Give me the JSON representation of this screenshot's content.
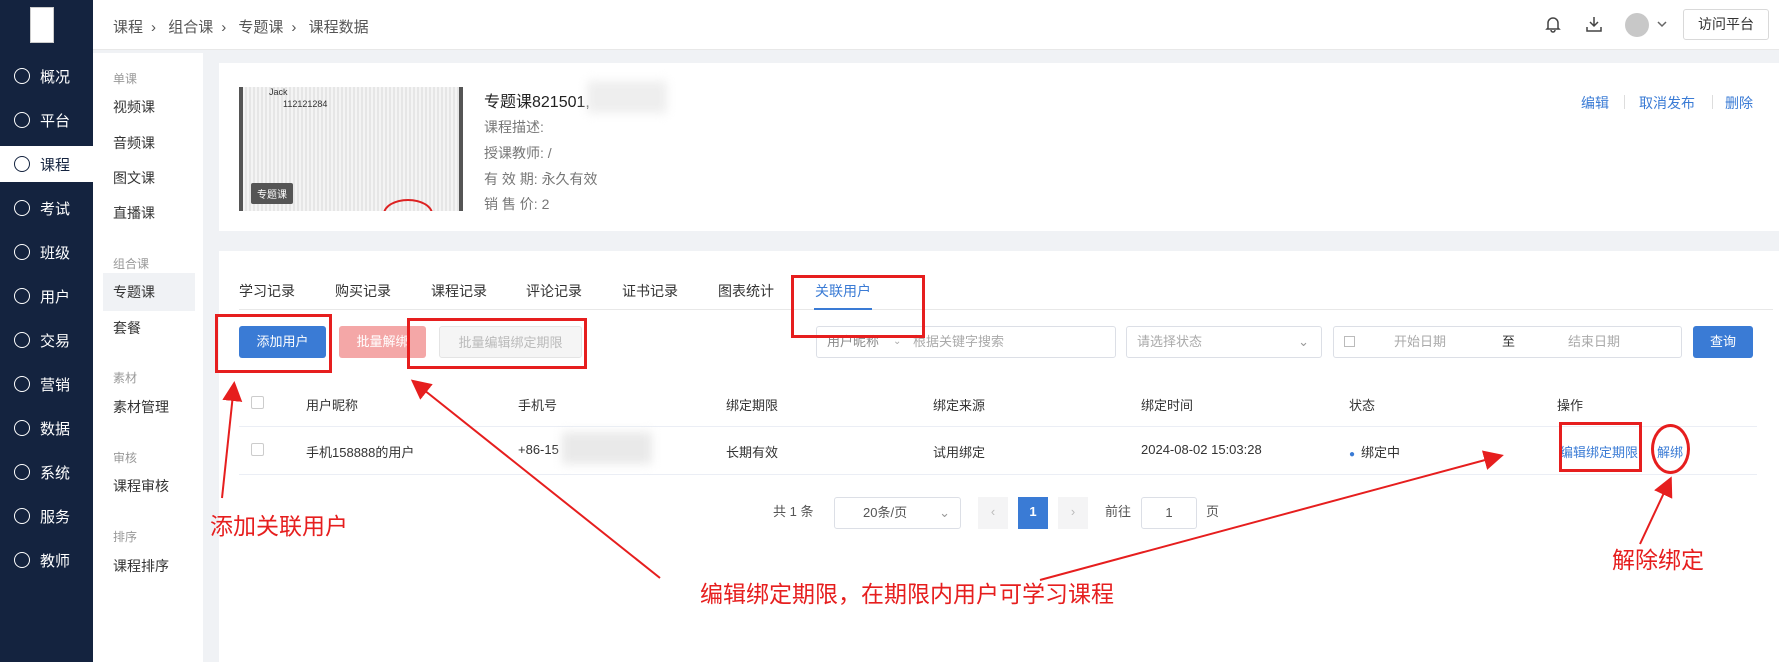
{
  "nav": {
    "items": [
      "概况",
      "平台",
      "课程",
      "考试",
      "班级",
      "用户",
      "交易",
      "营销",
      "数据",
      "系统",
      "服务",
      "教师"
    ],
    "active": "课程"
  },
  "submenu": {
    "groups": [
      {
        "heading": "单课",
        "items": [
          "视频课",
          "音频课",
          "图文课",
          "直播课"
        ]
      },
      {
        "heading": "组合课",
        "items": [
          "专题课",
          "套餐"
        ]
      },
      {
        "heading": "素材",
        "items": [
          "素材管理"
        ]
      },
      {
        "heading": "审核",
        "items": [
          "课程审核"
        ]
      },
      {
        "heading": "排序",
        "items": [
          "课程排序"
        ]
      }
    ],
    "active": "专题课"
  },
  "topbar": {
    "breadcrumb": [
      "课程",
      "组合课",
      "专题课",
      "课程数据"
    ],
    "visit_label": "访问平台",
    "icons": [
      "bell-icon",
      "download-icon",
      "avatar-icon",
      "chevron-down-icon"
    ]
  },
  "course": {
    "thumb_text1": "Jack",
    "thumb_text2": "112121284",
    "thumb_badge": "专题课",
    "title": "专题课821501,",
    "desc_label": "课程描述:",
    "teacher_label": "授课教师:",
    "teacher": "/",
    "valid_label": "有 效 期:",
    "valid": "永久有效",
    "price_label": "销 售 价:",
    "price": "2",
    "actions": [
      "编辑",
      "取消发布",
      "删除"
    ]
  },
  "tabs": {
    "items": [
      "学习记录",
      "购买记录",
      "课程记录",
      "评论记录",
      "证书记录",
      "图表统计",
      "关联用户"
    ],
    "active": "关联用户"
  },
  "toolbar": {
    "add_user": "添加用户",
    "batch_unbind": "批量解绑",
    "batch_edit": "批量编辑绑定期限",
    "search_type": "用户昵称",
    "search_placeholder": "根据关键字搜索",
    "status_placeholder": "请选择状态",
    "start_date": "开始日期",
    "to": "至",
    "end_date": "结束日期",
    "query": "查询"
  },
  "table": {
    "headers": [
      "用户昵称",
      "手机号",
      "绑定期限",
      "绑定来源",
      "绑定时间",
      "状态",
      "操作"
    ],
    "rows": [
      {
        "nickname": "手机158888的用户",
        "phone": "+86-15",
        "period": "长期有效",
        "source": "试用绑定",
        "time": "2024-08-02 15:03:28",
        "status": "绑定中",
        "op_edit": "编辑绑定期限",
        "op_unbind": "解绑"
      }
    ]
  },
  "pagination": {
    "total": "共 1 条",
    "page_size": "20条/页",
    "current": "1",
    "goto_label": "前往",
    "goto_value": "1",
    "page_unit": "页"
  },
  "annotations": {
    "add": "添加关联用户",
    "edit": "编辑绑定期限，在期限内用户可学习课程",
    "unbind": "解除绑定"
  },
  "colors": {
    "primary": "#3a7bd5",
    "nav_bg": "#14233f",
    "annotation": "#e61e1e"
  }
}
